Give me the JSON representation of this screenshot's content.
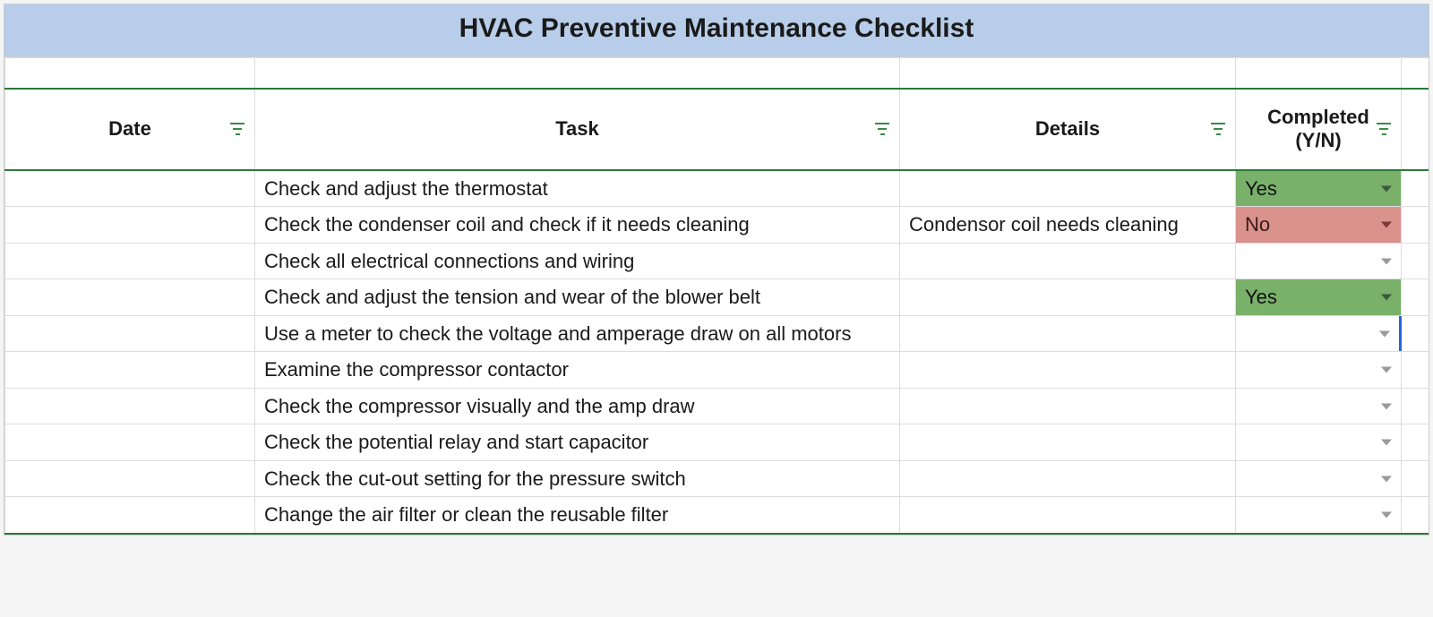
{
  "title": "HVAC Preventive Maintenance Checklist",
  "headers": {
    "date": "Date",
    "task": "Task",
    "details": "Details",
    "completed": "Completed (Y/N)"
  },
  "rows": [
    {
      "date": "",
      "task": "Check and adjust the thermostat",
      "details": "",
      "completed": "Yes"
    },
    {
      "date": "",
      "task": "Check the condenser coil and check if it needs cleaning",
      "details": "Condensor coil needs cleaning",
      "completed": "No"
    },
    {
      "date": "",
      "task": "Check all electrical connections and wiring",
      "details": "",
      "completed": ""
    },
    {
      "date": "",
      "task": "Check and adjust the tension and wear of the blower belt",
      "details": "",
      "completed": "Yes"
    },
    {
      "date": "",
      "task": "Use a meter to check the voltage and amperage draw on all motors",
      "details": "",
      "completed": ""
    },
    {
      "date": "",
      "task": "Examine the compressor contactor",
      "details": "",
      "completed": ""
    },
    {
      "date": "",
      "task": "Check the compressor visually and the amp draw",
      "details": "",
      "completed": ""
    },
    {
      "date": "",
      "task": "Check the potential relay and start capacitor",
      "details": "",
      "completed": ""
    },
    {
      "date": "",
      "task": "Check the cut-out setting for the pressure switch",
      "details": "",
      "completed": ""
    },
    {
      "date": "",
      "task": "Change the air filter or clean the reusable filter",
      "details": "",
      "completed": ""
    }
  ],
  "completed_colors": {
    "Yes": "#79b06a",
    "No": "#d9928c"
  }
}
